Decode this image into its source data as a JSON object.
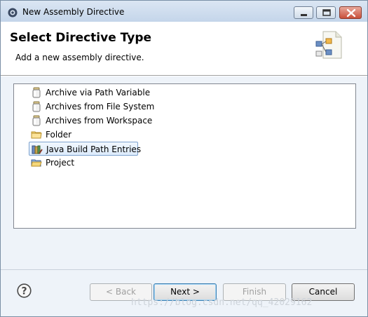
{
  "window": {
    "title": "New Assembly Directive",
    "app_icon": "eclipse-gear-icon"
  },
  "header": {
    "title": "Select Directive Type",
    "description": "Add a new assembly directive.",
    "icon": "assembly-wizard-icon"
  },
  "list": {
    "selected_index": 4,
    "items": [
      {
        "label": "Archive via Path Variable",
        "icon": "jar-icon"
      },
      {
        "label": "Archives from File System",
        "icon": "jar-icon"
      },
      {
        "label": "Archives from Workspace",
        "icon": "jar-icon"
      },
      {
        "label": "Folder",
        "icon": "folder-icon"
      },
      {
        "label": "Java Build Path Entries",
        "icon": "java-library-icon"
      },
      {
        "label": "Project",
        "icon": "project-folder-icon"
      }
    ]
  },
  "buttons": {
    "back": "< Back",
    "next": "Next >",
    "finish": "Finish",
    "cancel": "Cancel"
  },
  "watermark": "https://blog.csdn.net/qq_42029162",
  "colors": {
    "selection_border": "#7da2ce",
    "titlebar": "#c4d5ea",
    "close_button": "#c9503a"
  }
}
